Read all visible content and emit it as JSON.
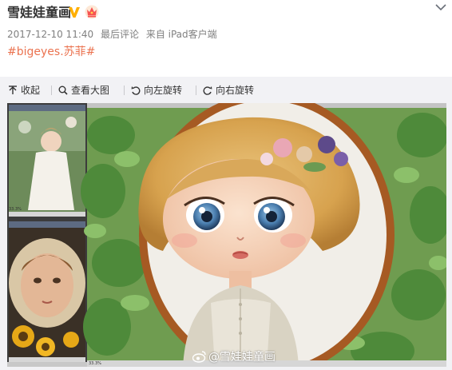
{
  "post": {
    "author": "雪娃娃童画",
    "date": "2017-12-10 11:40",
    "last_comment_label": "最后评论",
    "source": "来自 iPad客户端",
    "topic": "#bigeyes.苏菲#"
  },
  "toolbar": {
    "collapse_label": "收起",
    "view_large_label": "查看大图",
    "rotate_left_label": "向左旋转",
    "rotate_right_label": "向右旋转"
  },
  "photo": {
    "watermark_text": "@雪娃娃童画",
    "thumb_zoom_top": "33.3%",
    "thumb_zoom_bottom": "33.3%"
  },
  "colors": {
    "topic_link": "#eb7350",
    "verified_badge": "#ffaf00",
    "crown_badge": "#f7524f",
    "toolbar_bg": "#f2f2f5"
  },
  "icons": {
    "verified": "verified-v-icon",
    "crown": "crown-icon",
    "menu": "chevron-down-icon",
    "collapse": "collapse-arrow-icon",
    "magnify": "magnifier-icon",
    "rotate_left": "rotate-left-icon",
    "rotate_right": "rotate-right-icon",
    "weibo": "weibo-logo-icon"
  }
}
